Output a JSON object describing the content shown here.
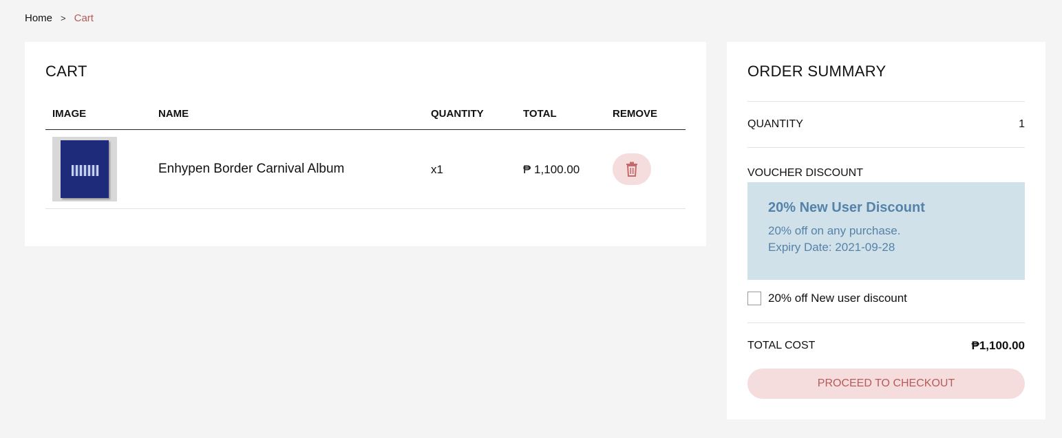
{
  "breadcrumb": {
    "home": "Home",
    "separator": ">",
    "current": "Cart"
  },
  "cart": {
    "title": "CART",
    "columns": {
      "image": "IMAGE",
      "name": "NAME",
      "quantity": "QUANTITY",
      "total": "TOTAL",
      "remove": "REMOVE"
    },
    "items": [
      {
        "name": "Enhypen Border Carnival Album",
        "quantity": "x1",
        "total": "₱ 1,100.00",
        "image_icon": "album-cover"
      }
    ]
  },
  "summary": {
    "title": "ORDER SUMMARY",
    "quantity_label": "QUANTITY",
    "quantity_value": "1",
    "voucher_label": "VOUCHER DISCOUNT",
    "voucher": {
      "title": "20% New User Discount",
      "description": "20% off on any purchase.",
      "expiry": "Expiry Date: 2021-09-28"
    },
    "voucher_checkbox_label": "20% off New user discount",
    "total_label": "TOTAL COST",
    "total_value": "₱1,100.00",
    "checkout_label": "PROCEED TO CHECKOUT"
  },
  "colors": {
    "accent": "#b55a5a",
    "accent_bg": "#f6dddd",
    "voucher_bg": "#d1e1ea",
    "voucher_text": "#5582a8"
  }
}
